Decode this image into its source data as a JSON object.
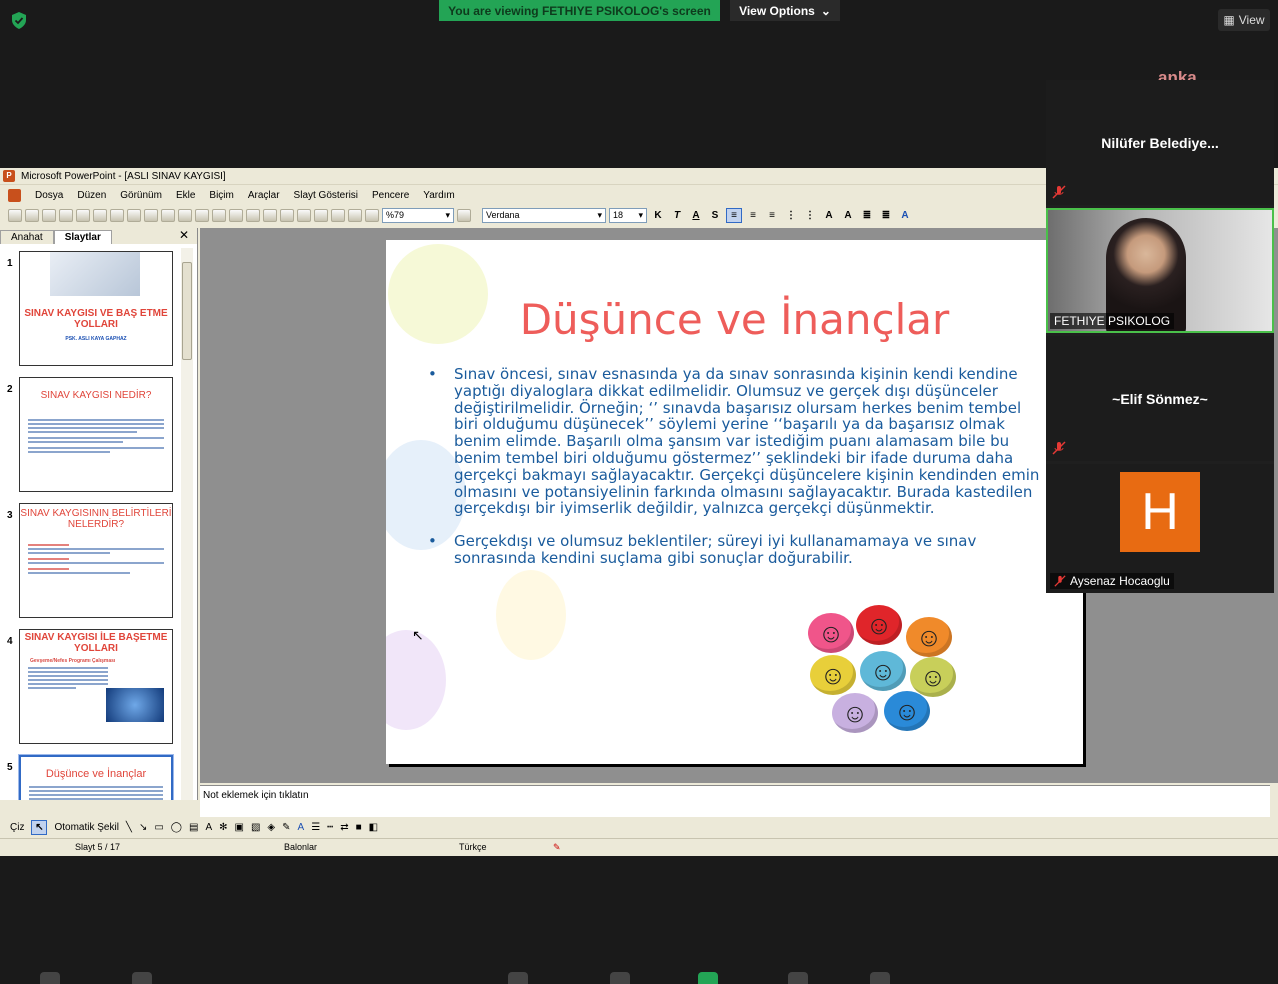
{
  "zoom": {
    "banner": "You are viewing FETHIYE PSIKOLOG's screen",
    "view_options": "View Options",
    "view_button": "View",
    "watermark": "anka",
    "participants": [
      {
        "name": "Nilüfer  Belediye..."
      },
      {
        "name": "FETHIYE PSIKOLOG"
      },
      {
        "name": "~Elif Sönmez~"
      },
      {
        "name": "Aysenaz Hocaoglu",
        "initial": "H"
      }
    ]
  },
  "ppt": {
    "window_title": "Microsoft PowerPoint - [ASLI SINAV KAYGISI]",
    "menu": [
      "Dosya",
      "Düzen",
      "Görünüm",
      "Ekle",
      "Biçim",
      "Araçlar",
      "Slayt Gösterisi",
      "Pencere",
      "Yardım"
    ],
    "zoom_level": "%79",
    "font_name": "Verdana",
    "font_size": "18",
    "format_buttons": [
      "K",
      "T",
      "A",
      "S"
    ],
    "tabs": [
      "Anahat",
      "Slaytlar"
    ],
    "close_glyph": "✕",
    "thumbnails": [
      {
        "num": "1",
        "title": "SINAV KAYGISI VE BAŞ ETME YOLLARI",
        "subtitle": "PSK. ASLI  KAYA GAPHAZ"
      },
      {
        "num": "2",
        "title": "SINAV KAYGISI NEDİR?"
      },
      {
        "num": "3",
        "title": "SINAV KAYGISININ BELİRTİLERİ NELERDİR?"
      },
      {
        "num": "4",
        "title": "SINAV KAYGISI İLE BAŞETME YOLLARI",
        "subtitle": "Gevşeme/Nefes Programı Çalışması"
      },
      {
        "num": "5",
        "title": "Düşünce ve İnançlar"
      }
    ],
    "slide": {
      "title": "Düşünce ve İnançlar",
      "bullets": [
        "Sınav öncesi, sınav esnasında ya da sınav sonrasında kişinin kendi kendine yaptığı diyaloglara dikkat edilmelidir. Olumsuz ve gerçek dışı düşünceler değiştirilmelidir. Örneğin; ‘’ sınavda başarısız olursam herkes benim tembel biri olduğumu düşünecek’’ söylemi yerine ‘‘başarılı ya da başarısız olmak benim elimde. Başarılı olma şansım var istediğim puanı alamasam bile bu benim tembel biri olduğumu göstermez’’ şeklindeki bir ifade duruma daha gerçekçi bakmayı sağlayacaktır. Gerçekçi düşüncelere kişinin kendinden emin olmasını ve potansiyelinin  farkında olmasını sağlayacaktır. Burada kastedilen gerçekdışı bir iyimserlik değildir, yalnızca  gerçekçi düşünmektir.",
        "Gerçekdışı ve olumsuz beklentiler; süreyi iyi kullanamamaya ve sınav sonrasında kendini suçlama gibi sonuçlar doğurabilir."
      ]
    },
    "notes_placeholder": "Not eklemek için tıklatın",
    "draw_label": "Çiz",
    "autoshape_label": "Otomatik Şekil",
    "status": {
      "slide": "Slayt 5 / 17",
      "theme": "Balonlar",
      "language": "Türkçe"
    }
  }
}
